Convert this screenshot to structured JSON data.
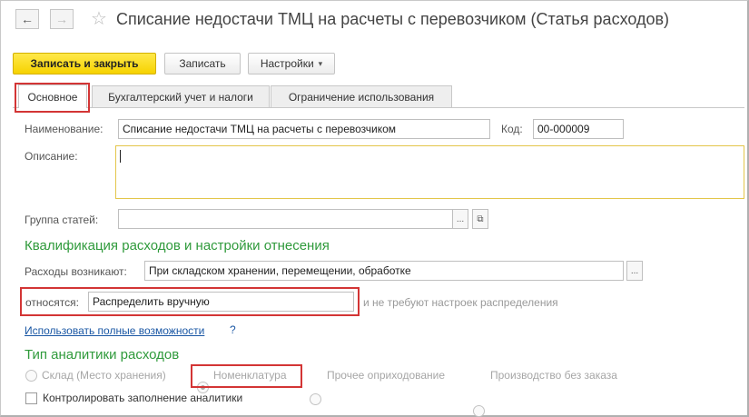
{
  "header": {
    "back_icon": "←",
    "forward_icon": "→",
    "favorite_icon": "☆",
    "title": "Списание недостачи ТМЦ на расчеты с перевозчиком (Статья расходов)"
  },
  "toolbar": {
    "save_close_label": "Записать и закрыть",
    "save_label": "Записать",
    "settings_label": "Настройки",
    "settings_arrow": "▾"
  },
  "tabs": [
    {
      "label": "Основное",
      "active": true
    },
    {
      "label": "Бухгалтерский учет и налоги",
      "active": false
    },
    {
      "label": "Ограничение использования",
      "active": false
    }
  ],
  "form": {
    "name_label": "Наименование:",
    "name_value": "Списание недостачи ТМЦ на расчеты с перевозчиком",
    "code_label": "Код:",
    "code_value": "00-000009",
    "description_label": "Описание:",
    "description_value": "",
    "group_label": "Группа статей:",
    "group_value": "",
    "select_icon": "...",
    "open_icon": "⧉"
  },
  "qualification": {
    "section_title": "Квалификация расходов и настройки отнесения",
    "arise_label": "Расходы возникают:",
    "arise_value": "При складском хранении, перемещении, обработке",
    "select_icon": "...",
    "relate_label": "относятся:",
    "relate_value": "Распределить вручную",
    "relate_hint": "и не требуют настроек распределения",
    "full_features_link": "Использовать полные возможности",
    "help_icon": "?"
  },
  "analytics": {
    "section_title": "Тип аналитики расходов",
    "options": [
      {
        "label": "Склад (Место хранения)",
        "checked": false
      },
      {
        "label": "Номенклатура",
        "checked": true
      },
      {
        "label": "Прочее оприходование",
        "checked": false
      },
      {
        "label": "Производство без заказа",
        "checked": false
      }
    ],
    "control_label": "Контролировать заполнение аналитики",
    "control_checked": false
  },
  "colors": {
    "accent_yellow": "#f6d200",
    "section_green": "#2f9a3b",
    "link_blue": "#1a57a4",
    "highlight_red": "#d33535"
  }
}
